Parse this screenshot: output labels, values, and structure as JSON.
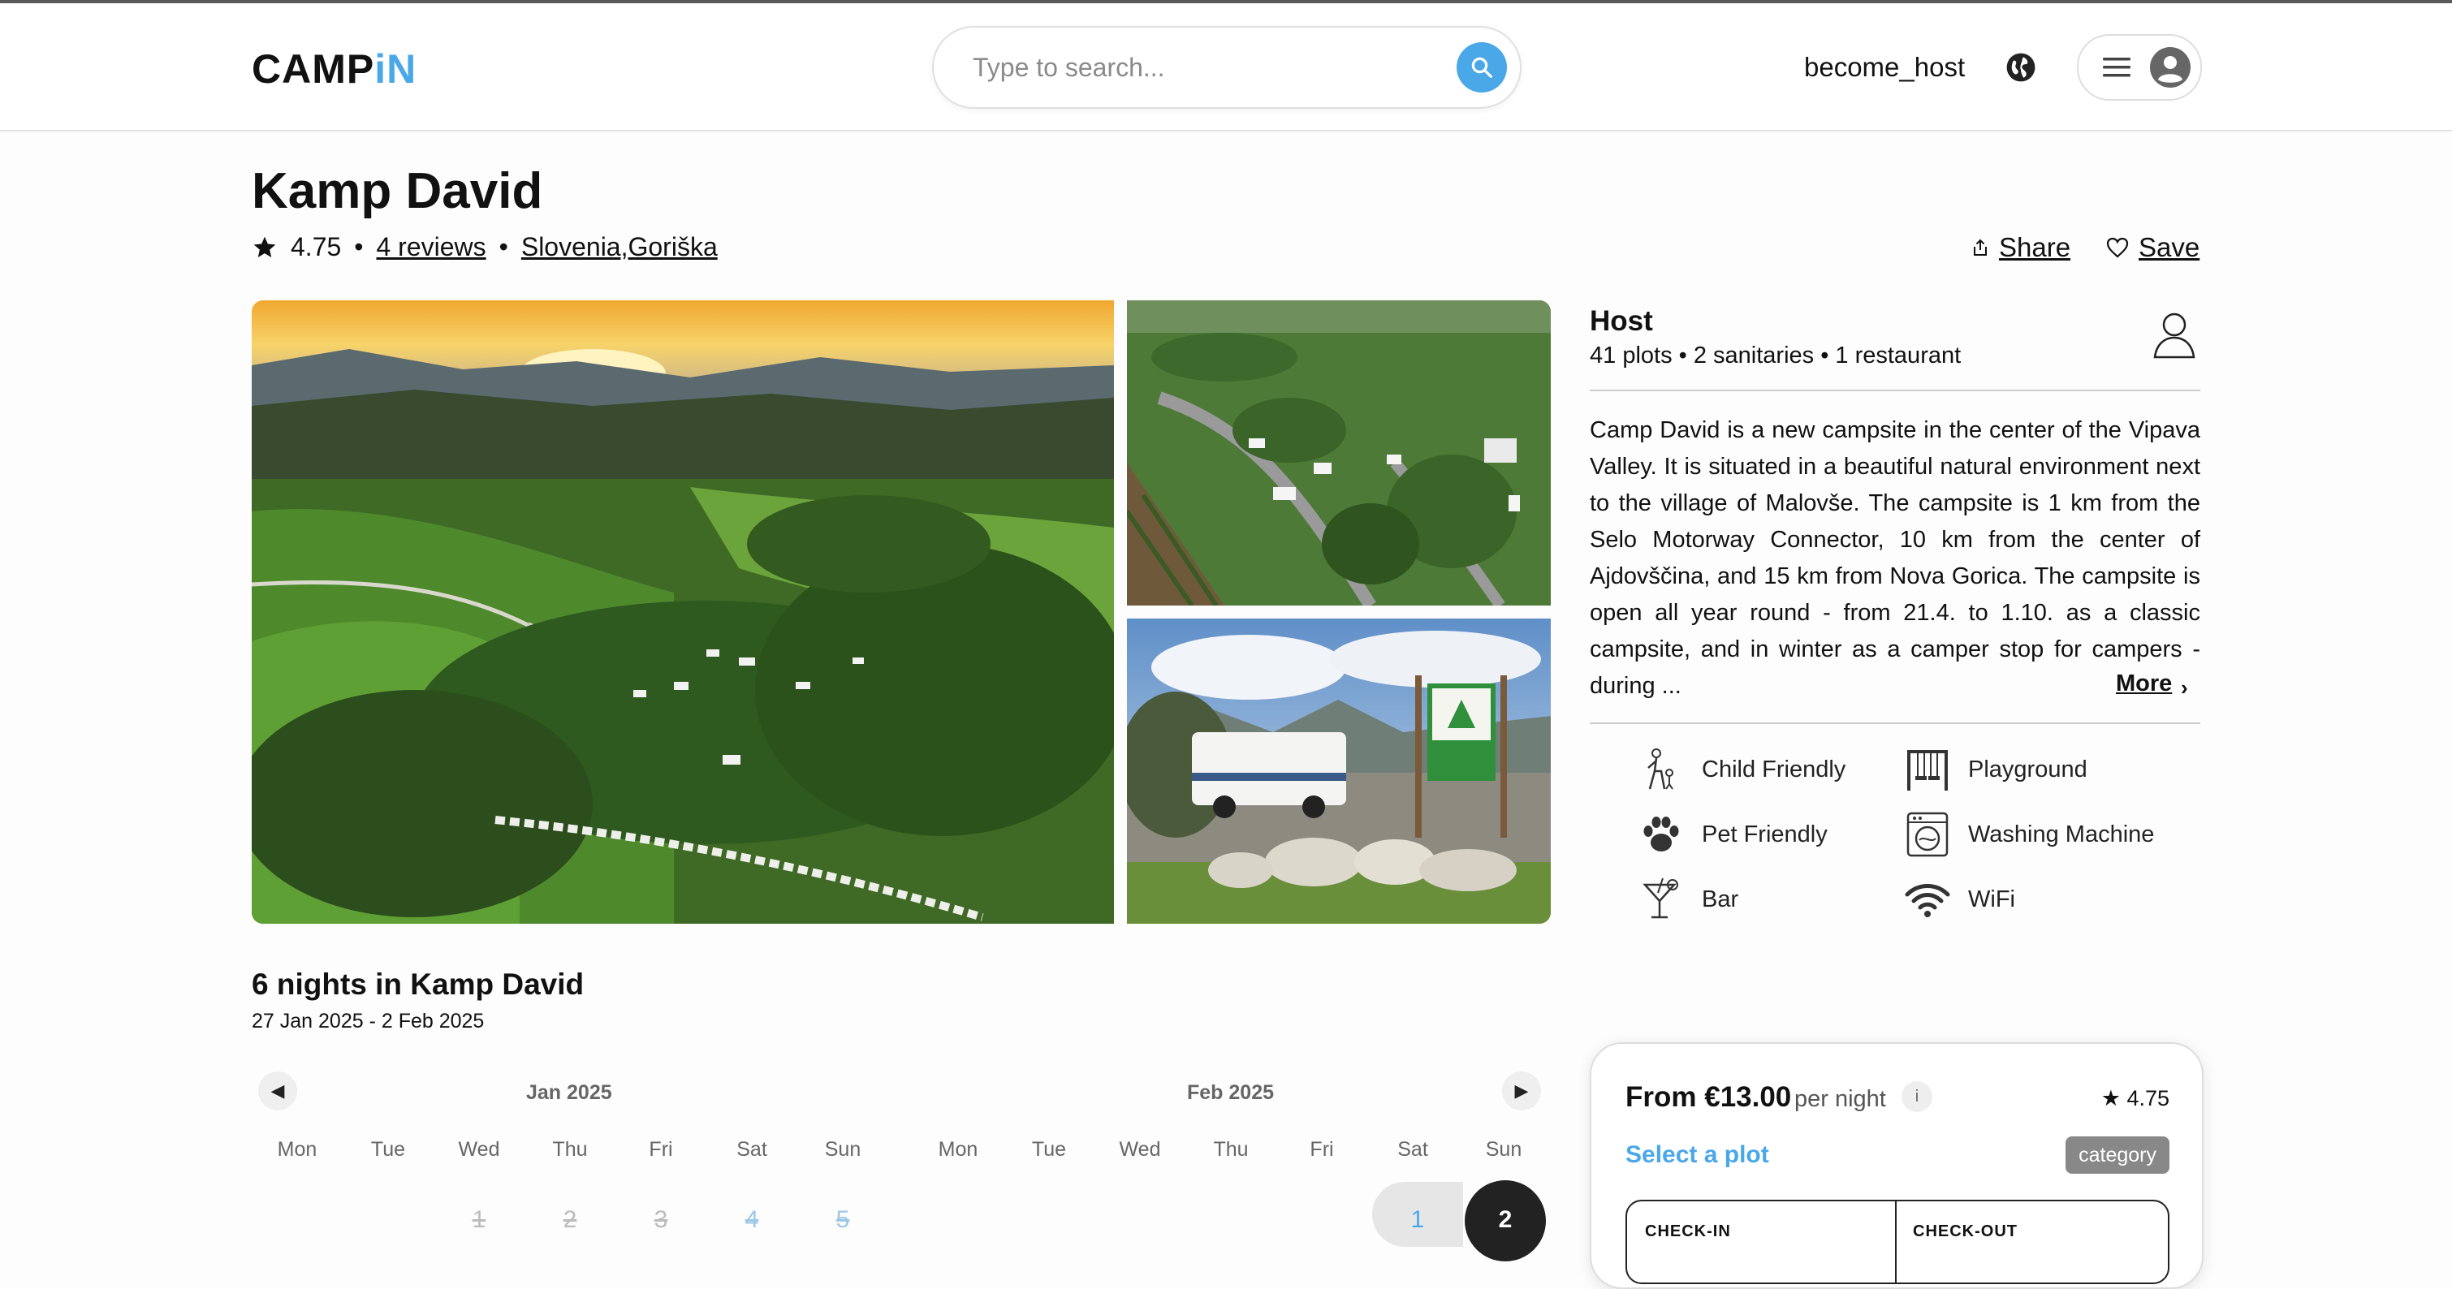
{
  "header": {
    "logo_dark": "CAMP",
    "logo_blue": "iN",
    "search_placeholder": "Type to search...",
    "become_host": "become_host"
  },
  "listing": {
    "title": "Kamp David",
    "rating": "4.75",
    "reviews": "4 reviews",
    "location": "Slovenia,Goriška",
    "share_label": "Share",
    "save_label": "Save"
  },
  "host": {
    "title": "Host",
    "summary": "41 plots • 2 sanitaries • 1 restaurant",
    "description": "Camp David is a new campsite in the center of the Vipava Valley. It is situated in a beautiful natural environment next to the village of Malovše. The campsite is 1 km from the Selo Motorway Connector, 10 km from the center of Ajdovščina, and 15 km from Nova Gorica. The campsite is open all year round - from 21.4. to 1.10. as a classic campsite, and in winter as a camper stop for campers - during ...",
    "more_label": "More"
  },
  "amenities": [
    {
      "label": "Child Friendly",
      "icon": "child-icon"
    },
    {
      "label": "Playground",
      "icon": "swing-icon"
    },
    {
      "label": "Pet Friendly",
      "icon": "paw-icon"
    },
    {
      "label": "Washing Machine",
      "icon": "washing-machine-icon"
    },
    {
      "label": "Bar",
      "icon": "cocktail-icon"
    },
    {
      "label": "WiFi",
      "icon": "wifi-icon"
    }
  ],
  "stay": {
    "title": "6 nights in Kamp David",
    "dates": "27 Jan 2025 - 2 Feb 2025"
  },
  "calendar": {
    "months": [
      "Jan 2025",
      "Feb 2025"
    ],
    "weekdays": [
      "Mon",
      "Tue",
      "Wed",
      "Thu",
      "Fri",
      "Sat",
      "Sun"
    ],
    "jan_visible_days": [
      "1",
      "2",
      "3",
      "4",
      "5"
    ],
    "feb_visible_days": [
      "1",
      "2"
    ]
  },
  "booking": {
    "price": "From €13.00",
    "per_night": "per night",
    "info": "i",
    "rating": "★ 4.75",
    "select_plot": "Select a plot",
    "category": "category",
    "check_in": "CHECK-IN",
    "check_out": "CHECK-OUT"
  },
  "colors": {
    "accent": "#4aa8e8",
    "text": "#111111"
  }
}
